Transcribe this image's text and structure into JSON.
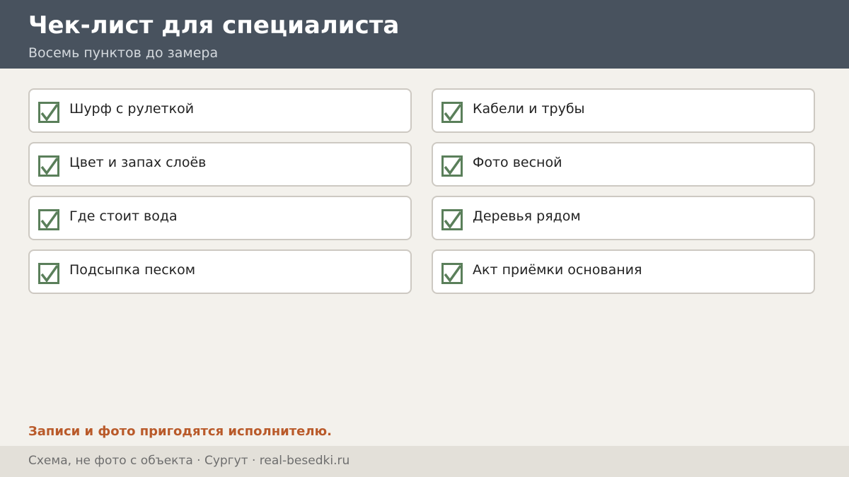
{
  "header": {
    "title": "Чек-лист для специалиста",
    "subtitle": "Восемь пунктов до замера"
  },
  "checklist": {
    "left": [
      {
        "label": "Шурф с рулеткой",
        "checked": true
      },
      {
        "label": "Цвет и запах слоёв",
        "checked": true
      },
      {
        "label": "Где стоит вода",
        "checked": true
      },
      {
        "label": "Подсыпка песком",
        "checked": true
      }
    ],
    "right": [
      {
        "label": "Кабели и трубы",
        "checked": true
      },
      {
        "label": "Фото весной",
        "checked": true
      },
      {
        "label": "Деревья рядом",
        "checked": true
      },
      {
        "label": "Акт приёмки основания",
        "checked": true
      }
    ]
  },
  "note": "Записи и фото пригодятся исполнителю.",
  "footer": {
    "text": "Схема, не фото с объекта  ·  Сургут  ·  real-besedki.ru"
  },
  "colors": {
    "header_bg": "#48525e",
    "page_bg": "#f3f1ec",
    "check_green": "#5a7f5a",
    "note_accent": "#b95a2a",
    "footer_bg": "#e3e0d9"
  }
}
